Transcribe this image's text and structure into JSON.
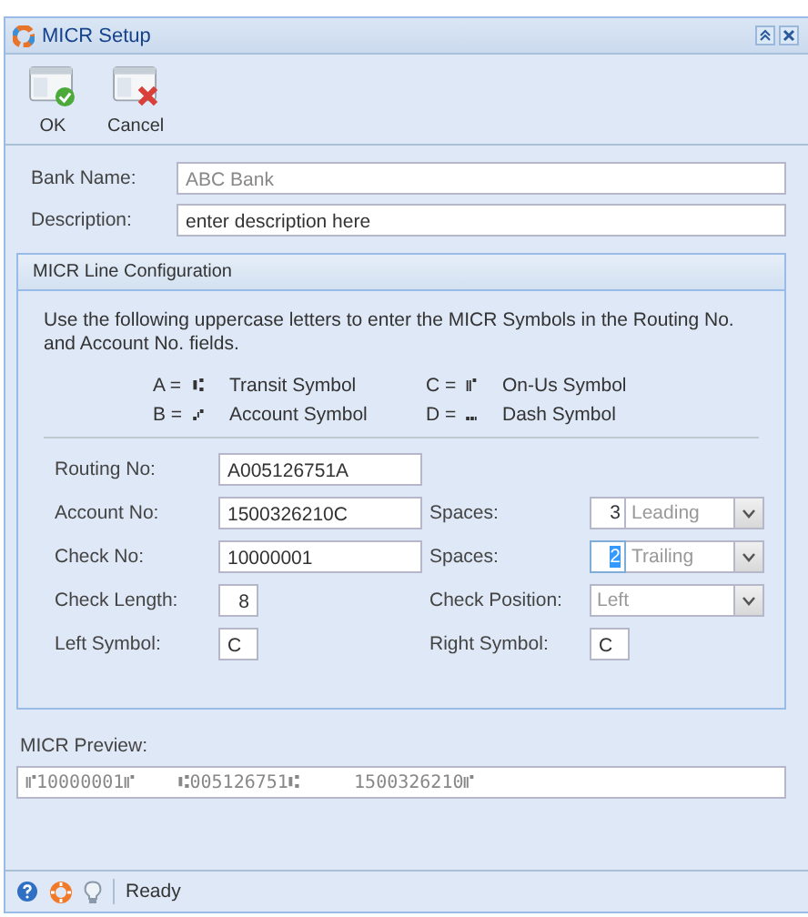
{
  "window": {
    "title": "MICR Setup"
  },
  "toolbar": [
    {
      "label": "OK",
      "kind": "ok"
    },
    {
      "label": "Cancel",
      "kind": "cancel"
    }
  ],
  "fields": [
    {
      "label": "Bank Name:",
      "value": "ABC Bank",
      "greyed": true
    },
    {
      "label": "Description:",
      "value": "enter description here",
      "greyed": false
    }
  ],
  "group": {
    "title": "MICR Line Configuration",
    "instructions": "Use the following uppercase letters to enter the MICR Symbols in the Routing No. and Account No. fields.",
    "symbols": [
      {
        "letter": "A =",
        "glyph": "⑆",
        "name": "Transit Symbol"
      },
      {
        "letter": "C =",
        "glyph": "⑈",
        "name": "On-Us Symbol"
      },
      {
        "letter": "B =",
        "glyph": "⑇",
        "name": "Account Symbol"
      },
      {
        "letter": "D =",
        "glyph": "⑉",
        "name": "Dash Symbol"
      }
    ],
    "routing_no": {
      "label": "Routing No:",
      "value": "A005126751A"
    },
    "account_no": {
      "label": "Account No:",
      "value": "1500326210C"
    },
    "account_spaces": {
      "label": "Spaces:",
      "count": "3",
      "position": "Leading",
      "text_selected": false
    },
    "check_no": {
      "label": "Check No:",
      "value": "10000001"
    },
    "check_spaces": {
      "label": "Spaces:",
      "count": "2",
      "position": "Trailing",
      "text_selected": true
    },
    "check_length": {
      "label": "Check Length:",
      "value": "8"
    },
    "check_position": {
      "label": "Check Position:",
      "value": "Left"
    },
    "left_symbol": {
      "label": "Left Symbol:",
      "value": "C"
    },
    "right_symbol": {
      "label": "Right Symbol:",
      "value": "C"
    }
  },
  "preview": {
    "label": "MICR Preview:",
    "value": "⑈10000001⑈    ⑆005126751⑆     1500326210⑈"
  },
  "status_bar": {
    "text": "Ready"
  }
}
